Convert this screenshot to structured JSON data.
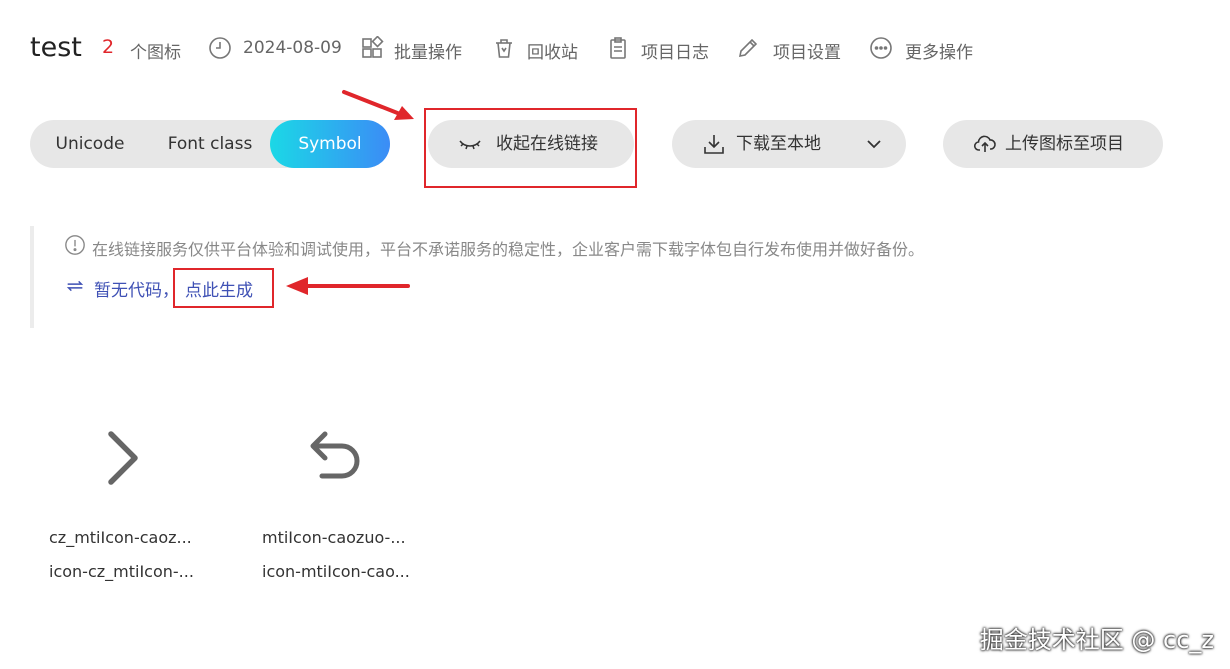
{
  "header": {
    "title": "test",
    "icon_count": "2",
    "icon_count_label": "个图标",
    "date": "2024-08-09",
    "batch_ops": "批量操作",
    "recycle_bin": "回收站",
    "project_log": "项目日志",
    "project_settings": "项目设置",
    "more_ops": "更多操作"
  },
  "toolbar": {
    "tabs": [
      "Unicode",
      "Font class",
      "Symbol"
    ],
    "active_tab": "Symbol",
    "collapse_link": "收起在线链接",
    "download": "下载至本地",
    "upload": "上传图标至项目"
  },
  "notice": {
    "message": "在线链接服务仅供平台体验和调试使用，平台不承诺服务的稳定性，企业客户需下载字体包自行发布使用并做好备份。",
    "no_code": "暂无代码，",
    "generate": "点此生成"
  },
  "icons": [
    {
      "name": "cz_mtiIcon-caoz...",
      "class": "icon-cz_mtiIcon-...",
      "glyph": "chevron-right-icon"
    },
    {
      "name": "mtiIcon-caozuo-...",
      "class": "icon-mtiIcon-cao...",
      "glyph": "undo-icon"
    }
  ],
  "watermark": "掘金技术社区 @ cc_z",
  "colors": {
    "accent_red": "#e0262b",
    "link_blue": "#3f51b5",
    "tab_gradient_start": "#1bd8e6",
    "tab_gradient_end": "#3b8cf6",
    "pill_bg": "#e7e7e7"
  }
}
